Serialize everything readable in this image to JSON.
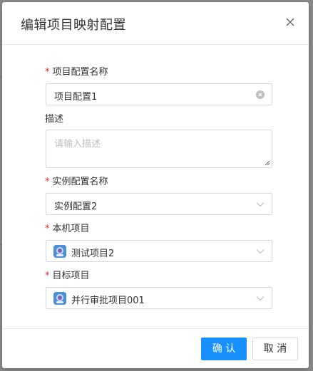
{
  "dialog": {
    "title": "编辑项目映射配置"
  },
  "form": {
    "project_config_name": {
      "label": "项目配置名称",
      "required_mark": "*",
      "value": "项目配置1"
    },
    "description": {
      "label": "描述",
      "placeholder": "请输入描述",
      "value": ""
    },
    "instance_config_name": {
      "label": "实例配置名称",
      "required_mark": "*",
      "value": "实例配置2"
    },
    "local_project": {
      "label": "本机项目",
      "required_mark": "*",
      "value": "测试项目2"
    },
    "target_project": {
      "label": "目标项目",
      "required_mark": "*",
      "value": "并行审批项目001"
    }
  },
  "footer": {
    "confirm_label": "确 认",
    "cancel_label": "取 消"
  },
  "colors": {
    "primary": "#1890ff",
    "required": "#f5222d",
    "project_icon": "#5aa9e6"
  }
}
